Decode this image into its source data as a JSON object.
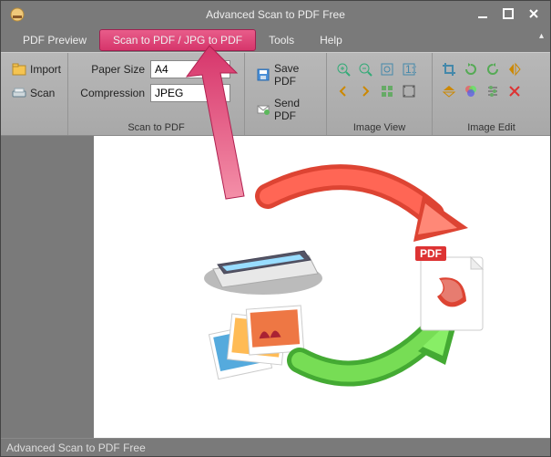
{
  "window": {
    "title": "Advanced Scan to PDF Free"
  },
  "menu": {
    "pdf_preview": "PDF Preview",
    "scan_to_pdf": "Scan to PDF / JPG to PDF",
    "tools": "Tools",
    "help": "Help"
  },
  "ribbon": {
    "group1": {
      "import": "Import",
      "scan": "Scan"
    },
    "group2": {
      "label": "Scan to PDF",
      "paper_size_label": "Paper Size",
      "paper_size_value": "A4",
      "compression_label": "Compression",
      "compression_value": "JPEG"
    },
    "group3": {
      "save_pdf": "Save PDF",
      "send_pdf": "Send PDF"
    },
    "group4": {
      "label": "Image View"
    },
    "group5": {
      "label": "Image Edit"
    }
  },
  "statusbar": {
    "text": "Advanced Scan to PDF Free"
  }
}
